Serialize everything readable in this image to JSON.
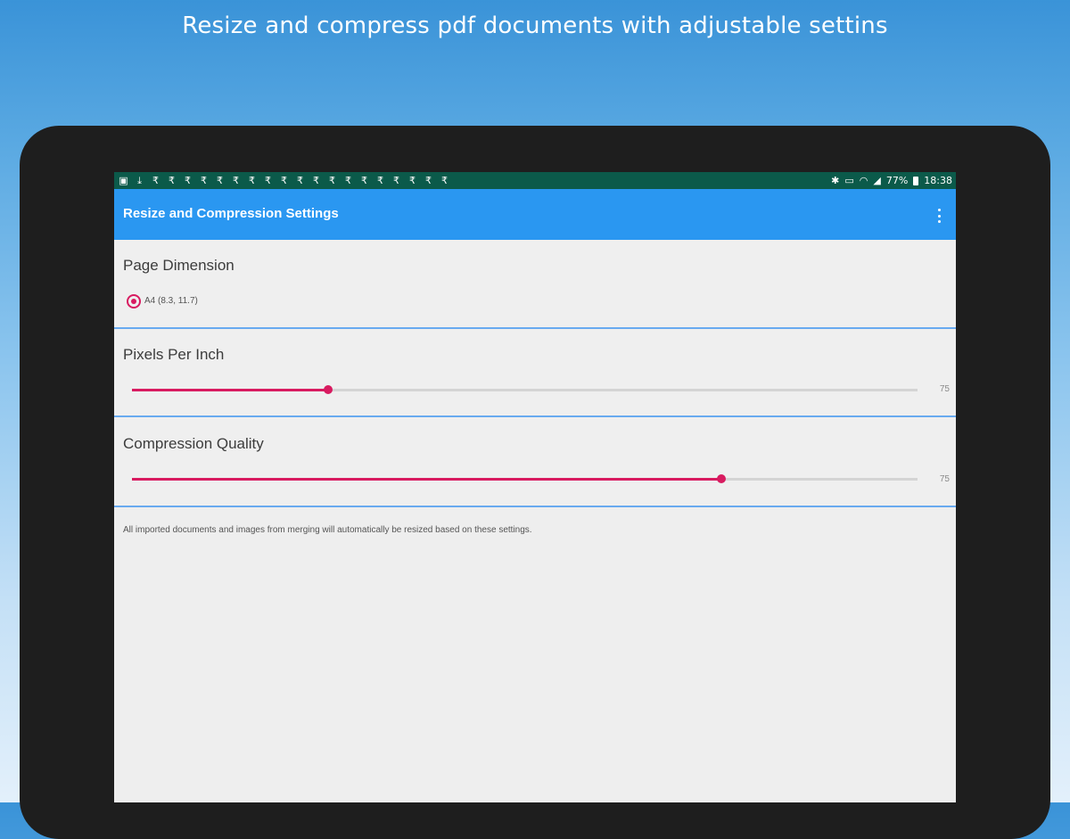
{
  "headline": "Resize and compress pdf documents with adjustable settins",
  "status_bar": {
    "left_icons": [
      "image-notification-icon",
      "download-icon",
      "rupee-notification-icon"
    ],
    "time": "18:38",
    "battery": "77%"
  },
  "app_bar": {
    "title": "Resize and Compression Settings",
    "menu_icon": "more-vert-icon"
  },
  "page_dimension": {
    "title": "Page Dimension",
    "selected_option": "A4 (8.3, 11.7)"
  },
  "pixels_per_inch": {
    "title": "Pixels Per Inch",
    "value": "75",
    "fraction": 0.25
  },
  "compression_quality": {
    "title": "Compression Quality",
    "value": "75",
    "fraction": 0.75
  },
  "note": "All imported documents and images from merging will automatically be resized based on these settings.",
  "colors": {
    "app_bar": "#2a97f1",
    "status_bar": "#0b5a4a",
    "accent": "#d81b60",
    "divider": "#68aaf0"
  }
}
